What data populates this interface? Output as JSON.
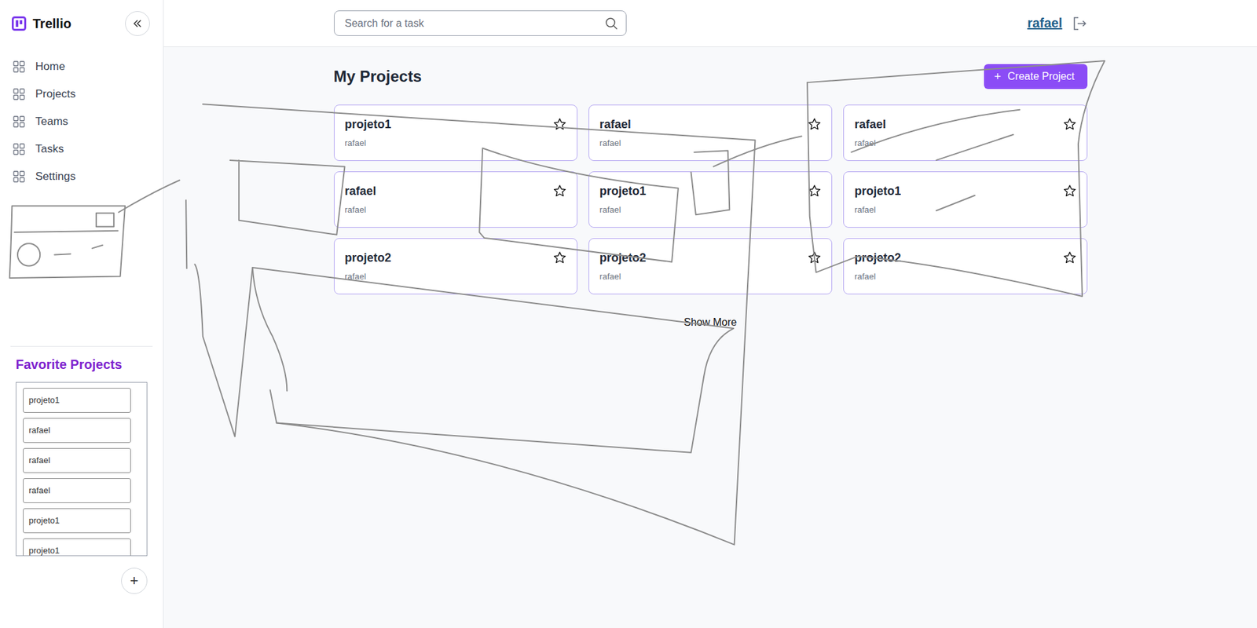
{
  "app": {
    "name": "Trellio"
  },
  "nav": [
    {
      "label": "Home"
    },
    {
      "label": "Projects"
    },
    {
      "label": "Teams"
    },
    {
      "label": "Tasks"
    },
    {
      "label": "Settings"
    }
  ],
  "search": {
    "placeholder": "Search for a task"
  },
  "user": {
    "name": "rafael"
  },
  "page": {
    "title": "My Projects",
    "create_icon": "+",
    "create_label": "Create Project",
    "show_more": "Show More"
  },
  "projects": [
    {
      "name": "projeto1",
      "owner": "rafael",
      "starred": false
    },
    {
      "name": "rafael",
      "owner": "rafael",
      "starred": false
    },
    {
      "name": "rafael",
      "owner": "rafael",
      "starred": false
    },
    {
      "name": "rafael",
      "owner": "rafael",
      "starred": false
    },
    {
      "name": "projeto1",
      "owner": "rafael",
      "starred": false
    },
    {
      "name": "projeto1",
      "owner": "rafael",
      "starred": false
    },
    {
      "name": "projeto2",
      "owner": "rafael",
      "starred": false
    },
    {
      "name": "projeto2",
      "owner": "rafael",
      "starred": false
    },
    {
      "name": "projeto2",
      "owner": "rafael",
      "starred": false
    }
  ],
  "favorites": {
    "title": "Favorite Projects",
    "items": [
      "projeto1",
      "rafael",
      "rafael",
      "rafael",
      "projeto1",
      "projeto1"
    ],
    "add_button": "+"
  }
}
